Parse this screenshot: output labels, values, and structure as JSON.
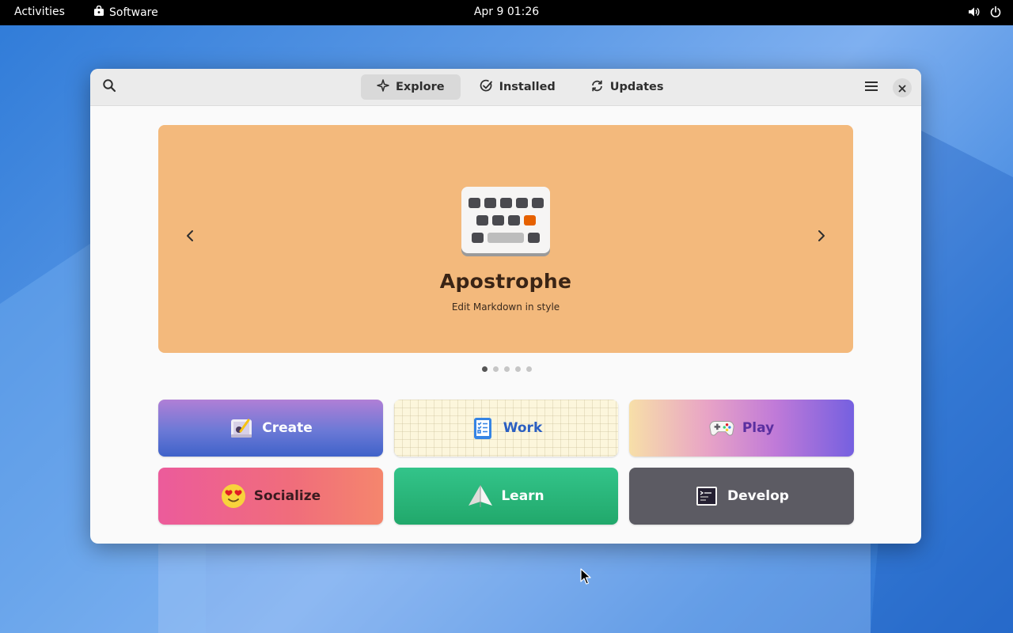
{
  "topbar": {
    "activities": "Activities",
    "app_name": "Software",
    "clock": "Apr 9  01:26",
    "icons": [
      "volume-icon",
      "power-icon"
    ]
  },
  "window": {
    "header": {
      "tabs": [
        {
          "label": "Explore",
          "icon": "explore-sparkle-icon",
          "active": true
        },
        {
          "label": "Installed",
          "icon": "check-circle-icon",
          "active": false
        },
        {
          "label": "Updates",
          "icon": "refresh-icon",
          "active": false
        }
      ],
      "icons": [
        "search-icon",
        "hamburger-menu-icon",
        "close-icon"
      ]
    },
    "featured": {
      "app_name": "Apostrophe",
      "description": "Edit Markdown in style",
      "background": "#f3b97c",
      "carousel": {
        "total": 5,
        "active_index": 0
      }
    },
    "categories": [
      {
        "label": "Create",
        "icon": "create-icon"
      },
      {
        "label": "Work",
        "icon": "clipboard-checklist-icon"
      },
      {
        "label": "Play",
        "icon": "gamepad-icon"
      },
      {
        "label": "Socialize",
        "icon": "heart-eyes-emoji-icon"
      },
      {
        "label": "Learn",
        "icon": "paper-plane-icon"
      },
      {
        "label": "Develop",
        "icon": "terminal-icon"
      }
    ]
  },
  "colors": {
    "topbar": "#000000",
    "accent_blue": "#2b5fc2",
    "learn_green": "#21a86b",
    "develop_gray": "#5c5b63"
  }
}
